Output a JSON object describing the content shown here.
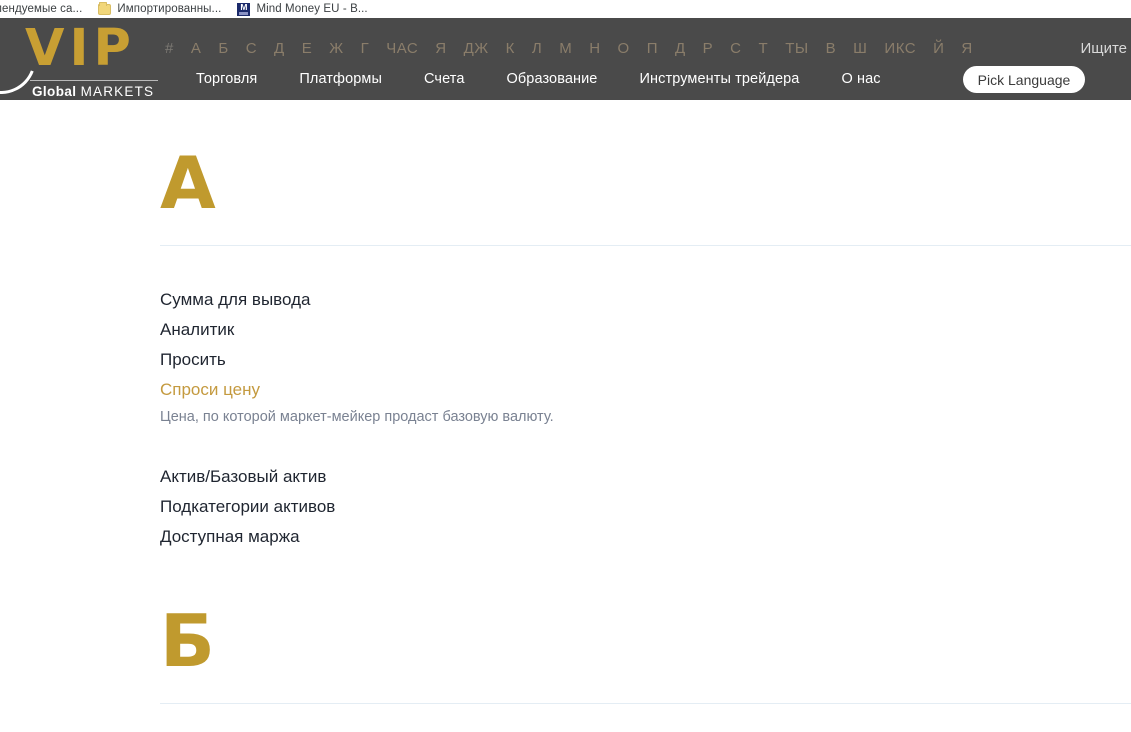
{
  "browser": {
    "bookmarks": [
      {
        "label": "мендуемые са...",
        "icon": "none-icon"
      },
      {
        "label": "Импортированны...",
        "icon": "folder-icon"
      },
      {
        "label": "Mind Money EU - В...",
        "icon": "mind-money-favicon"
      }
    ]
  },
  "header": {
    "logo": {
      "main": "VIP",
      "sub_bold": "Global",
      "sub_light": "MARKETS"
    },
    "alphabet": [
      "#",
      "А",
      "Б",
      "С",
      "Д",
      "Е",
      "Ж",
      "Г",
      "ЧАС",
      "Я",
      "ДЖ",
      "К",
      "Л",
      "М",
      "Н",
      "О",
      "П",
      "Д",
      "Р",
      "С",
      "Т",
      "ТЫ",
      "В",
      "Ш",
      "ИКС",
      "Й",
      "Я"
    ],
    "search_label": "Ищите",
    "nav": [
      "Торговля",
      "Платформы",
      "Счета",
      "Образование",
      "Инструменты трейдера",
      "О нас"
    ],
    "pick_language": "Pick Language"
  },
  "colors": {
    "header_bg": "#4a4a4a",
    "gold": "#c09a2e",
    "gold_text": "#c49a3f",
    "divider": "#e4edf4",
    "term_text": "#1f2530",
    "desc_text": "#7a8292"
  },
  "glossary": {
    "sections": [
      {
        "letter": "А",
        "terms": [
          {
            "label": "Сумма для вывода",
            "active": false,
            "description": ""
          },
          {
            "label": "Аналитик",
            "active": false,
            "description": ""
          },
          {
            "label": "Просить",
            "active": false,
            "description": ""
          },
          {
            "label": "Спроси цену",
            "active": true,
            "description": "Цена, по которой маркет-мейкер продаст базовую валюту."
          },
          {
            "label": "Актив/Базовый актив",
            "active": false,
            "description": ""
          },
          {
            "label": "Подкатегории активов",
            "active": false,
            "description": ""
          },
          {
            "label": "Доступная маржа",
            "active": false,
            "description": ""
          }
        ]
      },
      {
        "letter": "Б",
        "terms": []
      }
    ]
  }
}
